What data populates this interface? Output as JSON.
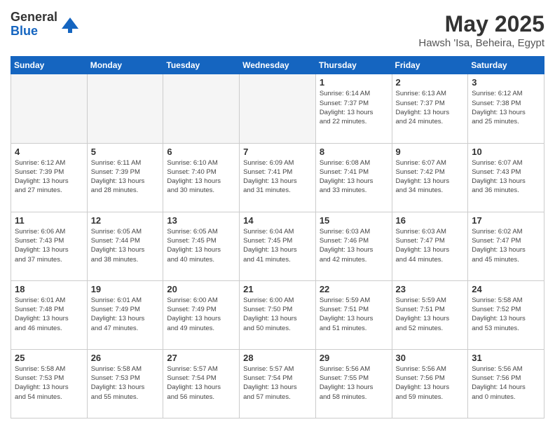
{
  "header": {
    "logo_general": "General",
    "logo_blue": "Blue",
    "title": "May 2025",
    "subtitle": "Hawsh 'Isa, Beheira, Egypt"
  },
  "days_of_week": [
    "Sunday",
    "Monday",
    "Tuesday",
    "Wednesday",
    "Thursday",
    "Friday",
    "Saturday"
  ],
  "weeks": [
    [
      {
        "day": "",
        "info": ""
      },
      {
        "day": "",
        "info": ""
      },
      {
        "day": "",
        "info": ""
      },
      {
        "day": "",
        "info": ""
      },
      {
        "day": "1",
        "info": "Sunrise: 6:14 AM\nSunset: 7:37 PM\nDaylight: 13 hours\nand 22 minutes."
      },
      {
        "day": "2",
        "info": "Sunrise: 6:13 AM\nSunset: 7:37 PM\nDaylight: 13 hours\nand 24 minutes."
      },
      {
        "day": "3",
        "info": "Sunrise: 6:12 AM\nSunset: 7:38 PM\nDaylight: 13 hours\nand 25 minutes."
      }
    ],
    [
      {
        "day": "4",
        "info": "Sunrise: 6:12 AM\nSunset: 7:39 PM\nDaylight: 13 hours\nand 27 minutes."
      },
      {
        "day": "5",
        "info": "Sunrise: 6:11 AM\nSunset: 7:39 PM\nDaylight: 13 hours\nand 28 minutes."
      },
      {
        "day": "6",
        "info": "Sunrise: 6:10 AM\nSunset: 7:40 PM\nDaylight: 13 hours\nand 30 minutes."
      },
      {
        "day": "7",
        "info": "Sunrise: 6:09 AM\nSunset: 7:41 PM\nDaylight: 13 hours\nand 31 minutes."
      },
      {
        "day": "8",
        "info": "Sunrise: 6:08 AM\nSunset: 7:41 PM\nDaylight: 13 hours\nand 33 minutes."
      },
      {
        "day": "9",
        "info": "Sunrise: 6:07 AM\nSunset: 7:42 PM\nDaylight: 13 hours\nand 34 minutes."
      },
      {
        "day": "10",
        "info": "Sunrise: 6:07 AM\nSunset: 7:43 PM\nDaylight: 13 hours\nand 36 minutes."
      }
    ],
    [
      {
        "day": "11",
        "info": "Sunrise: 6:06 AM\nSunset: 7:43 PM\nDaylight: 13 hours\nand 37 minutes."
      },
      {
        "day": "12",
        "info": "Sunrise: 6:05 AM\nSunset: 7:44 PM\nDaylight: 13 hours\nand 38 minutes."
      },
      {
        "day": "13",
        "info": "Sunrise: 6:05 AM\nSunset: 7:45 PM\nDaylight: 13 hours\nand 40 minutes."
      },
      {
        "day": "14",
        "info": "Sunrise: 6:04 AM\nSunset: 7:45 PM\nDaylight: 13 hours\nand 41 minutes."
      },
      {
        "day": "15",
        "info": "Sunrise: 6:03 AM\nSunset: 7:46 PM\nDaylight: 13 hours\nand 42 minutes."
      },
      {
        "day": "16",
        "info": "Sunrise: 6:03 AM\nSunset: 7:47 PM\nDaylight: 13 hours\nand 44 minutes."
      },
      {
        "day": "17",
        "info": "Sunrise: 6:02 AM\nSunset: 7:47 PM\nDaylight: 13 hours\nand 45 minutes."
      }
    ],
    [
      {
        "day": "18",
        "info": "Sunrise: 6:01 AM\nSunset: 7:48 PM\nDaylight: 13 hours\nand 46 minutes."
      },
      {
        "day": "19",
        "info": "Sunrise: 6:01 AM\nSunset: 7:49 PM\nDaylight: 13 hours\nand 47 minutes."
      },
      {
        "day": "20",
        "info": "Sunrise: 6:00 AM\nSunset: 7:49 PM\nDaylight: 13 hours\nand 49 minutes."
      },
      {
        "day": "21",
        "info": "Sunrise: 6:00 AM\nSunset: 7:50 PM\nDaylight: 13 hours\nand 50 minutes."
      },
      {
        "day": "22",
        "info": "Sunrise: 5:59 AM\nSunset: 7:51 PM\nDaylight: 13 hours\nand 51 minutes."
      },
      {
        "day": "23",
        "info": "Sunrise: 5:59 AM\nSunset: 7:51 PM\nDaylight: 13 hours\nand 52 minutes."
      },
      {
        "day": "24",
        "info": "Sunrise: 5:58 AM\nSunset: 7:52 PM\nDaylight: 13 hours\nand 53 minutes."
      }
    ],
    [
      {
        "day": "25",
        "info": "Sunrise: 5:58 AM\nSunset: 7:53 PM\nDaylight: 13 hours\nand 54 minutes."
      },
      {
        "day": "26",
        "info": "Sunrise: 5:58 AM\nSunset: 7:53 PM\nDaylight: 13 hours\nand 55 minutes."
      },
      {
        "day": "27",
        "info": "Sunrise: 5:57 AM\nSunset: 7:54 PM\nDaylight: 13 hours\nand 56 minutes."
      },
      {
        "day": "28",
        "info": "Sunrise: 5:57 AM\nSunset: 7:54 PM\nDaylight: 13 hours\nand 57 minutes."
      },
      {
        "day": "29",
        "info": "Sunrise: 5:56 AM\nSunset: 7:55 PM\nDaylight: 13 hours\nand 58 minutes."
      },
      {
        "day": "30",
        "info": "Sunrise: 5:56 AM\nSunset: 7:56 PM\nDaylight: 13 hours\nand 59 minutes."
      },
      {
        "day": "31",
        "info": "Sunrise: 5:56 AM\nSunset: 7:56 PM\nDaylight: 14 hours\nand 0 minutes."
      }
    ]
  ]
}
